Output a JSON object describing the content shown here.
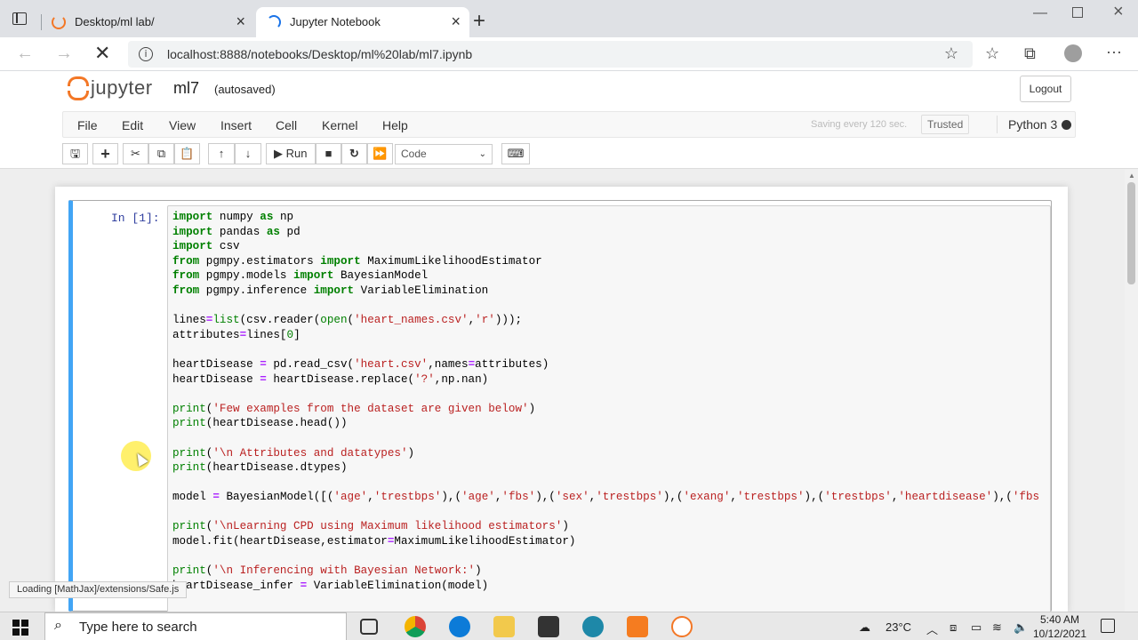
{
  "browser": {
    "tabs": [
      {
        "title": "Desktop/ml lab/",
        "active": false
      },
      {
        "title": "Jupyter Notebook",
        "active": true
      }
    ],
    "url": "localhost:8888/notebooks/Desktop/ml%20lab/ml7.ipynb"
  },
  "jupyter": {
    "logo_text": "jupyter",
    "notebook_name": "ml7",
    "autosave": "(autosaved)",
    "logout_label": "Logout",
    "menu": [
      "File",
      "Edit",
      "View",
      "Insert",
      "Cell",
      "Kernel",
      "Help"
    ],
    "saving_status": "Saving every 120 sec.",
    "trusted_label": "Trusted",
    "kernel_name": "Python 3",
    "run_label": "Run",
    "cell_type": "Code"
  },
  "cell": {
    "prompt": "In [1]:",
    "code_lines": [
      "import numpy as np",
      "import pandas as pd",
      "import csv",
      "from pgmpy.estimators import MaximumLikelihoodEstimator",
      "from pgmpy.models import BayesianModel",
      "from pgmpy.inference import VariableElimination",
      "",
      "lines=list(csv.reader(open('heart_names.csv','r')));",
      "attributes=lines[0]",
      "",
      "heartDisease = pd.read_csv('heart.csv',names=attributes)",
      "heartDisease = heartDisease.replace('?',np.nan)",
      "",
      "print('Few examples from the dataset are given below')",
      "print(heartDisease.head())",
      "",
      "print('\\n Attributes and datatypes')",
      "print(heartDisease.dtypes)",
      "",
      "model = BayesianModel([('age','trestbps'),('age','fbs'),('sex','trestbps'),('exang','trestbps'),('trestbps','heartdisease'),('fbs",
      "",
      "print('\\nLearning CPD using Maximum likelihood estimators')",
      "model.fit(heartDisease,estimator=MaximumLikelihoodEstimator)",
      "",
      "print('\\n Inferencing with Bayesian Network:')",
      "heartDisease_infer = VariableElimination(model)"
    ]
  },
  "status_message": "Loading [MathJax]/extensions/Safe.js",
  "taskbar": {
    "search_placeholder": "Type here to search",
    "temperature": "23°C",
    "time": "5:40 AM",
    "date": "10/12/2021"
  }
}
